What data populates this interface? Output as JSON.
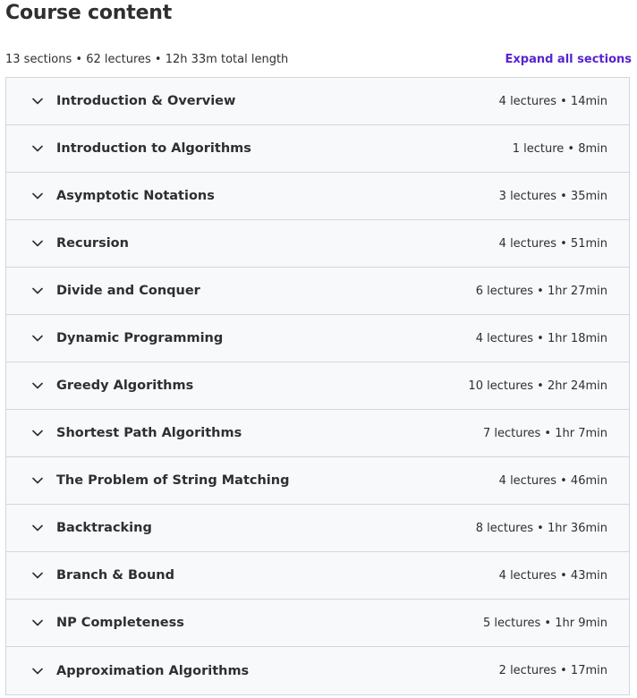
{
  "header": {
    "title": "Course content",
    "summary": "13 sections • 62 lectures • 12h 33m total length",
    "expand_label": "Expand all sections"
  },
  "icons": {
    "section_toggle": "chevron-down-icon"
  },
  "colors": {
    "text": "#2d2f31",
    "link": "#5624d0",
    "section_bg": "#f7f9fa",
    "border": "#d1d7dc"
  },
  "sections": [
    {
      "title": "Introduction & Overview",
      "meta": "4 lectures • 14min"
    },
    {
      "title": "Introduction to Algorithms",
      "meta": "1 lecture • 8min"
    },
    {
      "title": "Asymptotic Notations",
      "meta": "3 lectures • 35min"
    },
    {
      "title": "Recursion",
      "meta": "4 lectures • 51min"
    },
    {
      "title": "Divide and Conquer",
      "meta": "6 lectures • 1hr 27min"
    },
    {
      "title": "Dynamic Programming",
      "meta": "4 lectures • 1hr 18min"
    },
    {
      "title": "Greedy Algorithms",
      "meta": "10 lectures • 2hr 24min"
    },
    {
      "title": "Shortest Path Algorithms",
      "meta": "7 lectures • 1hr 7min"
    },
    {
      "title": "The Problem of String Matching",
      "meta": "4 lectures • 46min"
    },
    {
      "title": "Backtracking",
      "meta": "8 lectures • 1hr 36min"
    },
    {
      "title": "Branch & Bound",
      "meta": "4 lectures • 43min"
    },
    {
      "title": "NP Completeness",
      "meta": "5 lectures • 1hr 9min"
    },
    {
      "title": "Approximation Algorithms",
      "meta": "2 lectures • 17min"
    }
  ]
}
